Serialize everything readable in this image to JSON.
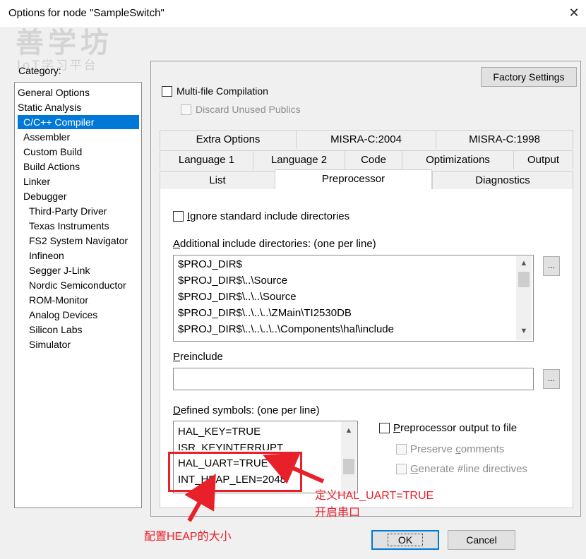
{
  "window": {
    "title": "Options for node \"SampleSwitch\"",
    "close_glyph": "✕"
  },
  "watermark": {
    "main": "善学坊",
    "sub": "IoT学习平台"
  },
  "category": {
    "label": "Category:",
    "items": [
      "General Options",
      "Static Analysis",
      "C/C++ Compiler",
      "Assembler",
      "Custom Build",
      "Build Actions",
      "Linker",
      "Debugger",
      "Third-Party Driver",
      "Texas Instruments",
      "FS2 System Navigator",
      "Infineon",
      "Segger J-Link",
      "Nordic Semiconductor",
      "ROM-Monitor",
      "Analog Devices",
      "Silicon Labs",
      "Simulator"
    ]
  },
  "factory_settings": "Factory Settings",
  "multi_file": "Multi-file Compilation",
  "discard_unused": "Discard Unused Publics",
  "tabs": {
    "row1": [
      "Extra Options",
      "MISRA-C:2004",
      "MISRA-C:1998"
    ],
    "row2": [
      "Language 1",
      "Language 2",
      "Code",
      "Optimizations",
      "Output"
    ],
    "row3": [
      "List",
      "Preprocessor",
      "Diagnostics"
    ]
  },
  "preprocessor": {
    "ignore_std_pre": "I",
    "ignore_std_post": "gnore standard include directories",
    "additional_pre": "A",
    "additional_post": "dditional include directories: (one per line)",
    "include_dirs": [
      "$PROJ_DIR$",
      "$PROJ_DIR$\\..\\Source",
      "$PROJ_DIR$\\..\\..\\Source",
      "$PROJ_DIR$\\..\\..\\..\\ZMain\\TI2530DB",
      "$PROJ_DIR$\\..\\..\\..\\..\\Components\\hal\\include"
    ],
    "preinclude_pre": "P",
    "preinclude_post": "reinclude",
    "defined_pre": "D",
    "defined_post": "efined symbols: (one per line)",
    "symbols": [
      "HAL_KEY=TRUE",
      "ISR_KEYINTERRUPT",
      "HAL_UART=TRUE",
      "INT_HEAP_LEN=2048"
    ],
    "output_to_file_pre": "P",
    "output_to_file_post": "reprocessor output to file",
    "preserve_pre": "Preserve ",
    "preserve_u": "c",
    "preserve_post": "omments",
    "generate_pre": "G",
    "generate_post": "enerate #line directives",
    "ellipsis": "..."
  },
  "buttons": {
    "ok": "OK",
    "cancel": "Cancel"
  },
  "annotations": {
    "uart_line1": "定义HAL_UART=TRUE",
    "uart_line2": "开启串口",
    "heap": "配置HEAP的大小"
  },
  "colors": {
    "selection": "#0078d7",
    "annotation": "#e8202a"
  }
}
